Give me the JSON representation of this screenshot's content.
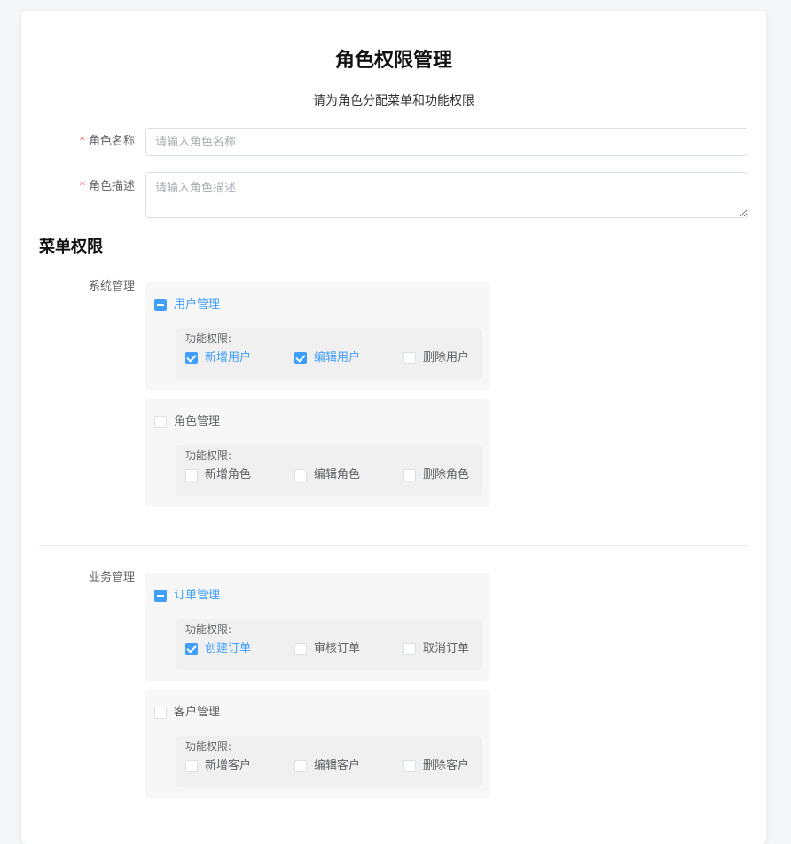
{
  "page": {
    "title": "角色权限管理",
    "subtitle": "请为角色分配菜单和功能权限"
  },
  "form": {
    "required_mark": "*",
    "name_label": "角色名称",
    "name_placeholder": "请输入角色名称",
    "name_value": "",
    "desc_label": "角色描述",
    "desc_placeholder": "请输入角色描述",
    "desc_value": ""
  },
  "menu_section": {
    "title": "菜单权限",
    "perm_title": "功能权限:",
    "groups": [
      {
        "label": "系统管理",
        "menus": [
          {
            "name": "用户管理",
            "state": "partial",
            "perms": [
              {
                "label": "新增用户",
                "checked": true
              },
              {
                "label": "编辑用户",
                "checked": true
              },
              {
                "label": "删除用户",
                "checked": false
              }
            ]
          },
          {
            "name": "角色管理",
            "state": "unchecked",
            "perms": [
              {
                "label": "新增角色",
                "checked": false
              },
              {
                "label": "编辑角色",
                "checked": false
              },
              {
                "label": "删除角色",
                "checked": false
              }
            ]
          }
        ]
      },
      {
        "label": "业务管理",
        "menus": [
          {
            "name": "订单管理",
            "state": "partial",
            "perms": [
              {
                "label": "创建订单",
                "checked": true
              },
              {
                "label": "审核订单",
                "checked": false
              },
              {
                "label": "取消订单",
                "checked": false
              }
            ]
          },
          {
            "name": "客户管理",
            "state": "unchecked",
            "perms": [
              {
                "label": "新增客户",
                "checked": false
              },
              {
                "label": "编辑客户",
                "checked": false
              },
              {
                "label": "删除客户",
                "checked": false
              }
            ]
          }
        ]
      }
    ]
  },
  "colors": {
    "accent": "#409eff",
    "required": "#f56c6c",
    "panel": "#f7f7f7",
    "perm_panel": "#f0f0f0"
  }
}
